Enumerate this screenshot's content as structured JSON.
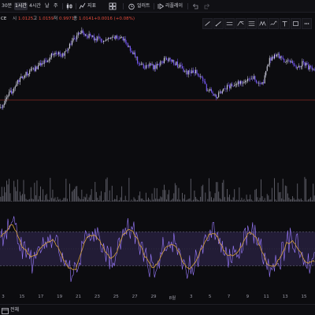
{
  "toolbar": {
    "intervals": [
      {
        "label": "30분",
        "active": false
      },
      {
        "label": "1시간",
        "active": true
      },
      {
        "label": "4시간",
        "active": false
      },
      {
        "label": "날",
        "active": false
      },
      {
        "label": "주",
        "active": false
      }
    ],
    "indicators_label": "지표",
    "alert_label": "얼러트",
    "replay_label": "리플레이",
    "icons": [
      "candle-icon",
      "indicator-icon",
      "template-icon",
      "alert-icon",
      "replay-icon",
      "undo-icon",
      "redo-icon"
    ]
  },
  "symbol": {
    "name_fragment": "CE",
    "open_label": "시",
    "open_value": "1.0125",
    "high_label": "고",
    "high_value": "1.0159",
    "low_label": "저",
    "low_value": "0.9971",
    "close_label": "종",
    "close_value": "1.0141",
    "change_value": "+0.0016 (+0.08%)"
  },
  "drawing_tools": [
    "trend-line-icon",
    "ray-icon",
    "horizontal-line-icon",
    "pitchfork-icon",
    "fib-icon",
    "pattern-icon",
    "brush-icon",
    "text-icon",
    "rectangle-icon",
    "more-icon"
  ],
  "date_axis": [
    "3",
    "15",
    "17",
    "19",
    "21",
    "23",
    "25",
    "27",
    "29",
    "8월",
    "3",
    "5",
    "7",
    "9",
    "11",
    "13",
    "15"
  ],
  "bottom_bar": {
    "range_label": "전체"
  },
  "colors": {
    "background": "#0c0c0f",
    "up": "#d4d4e4",
    "down": "#7b5cff",
    "price_line": "#c0392b",
    "oscillator": "#9b7bff",
    "signal": "#d8a33a",
    "band_fill": "#2a2144",
    "volume": "#6d6d78"
  },
  "chart_data": {
    "type": "line",
    "title": "",
    "price_pane": {
      "y_shape": [
        0.28,
        0.36,
        0.45,
        0.52,
        0.58,
        0.62,
        0.65,
        0.7,
        0.73,
        0.79,
        0.8,
        0.77,
        0.86,
        0.94,
        1.0,
        0.97,
        0.95,
        0.93,
        0.91,
        0.92,
        0.94,
        0.95,
        0.89,
        0.82,
        0.72,
        0.66,
        0.69,
        0.66,
        0.71,
        0.74,
        0.73,
        0.69,
        0.63,
        0.61,
        0.62,
        0.59,
        0.47,
        0.42,
        0.39,
        0.45,
        0.48,
        0.5,
        0.52,
        0.55,
        0.58,
        0.53,
        0.5,
        0.72,
        0.78,
        0.76,
        0.72,
        0.7,
        0.67,
        0.71,
        0.66,
        0.64
      ]
    },
    "oscillator_pane": {
      "band_upper": 70,
      "band_lower": 30,
      "band_mid": 50
    }
  }
}
